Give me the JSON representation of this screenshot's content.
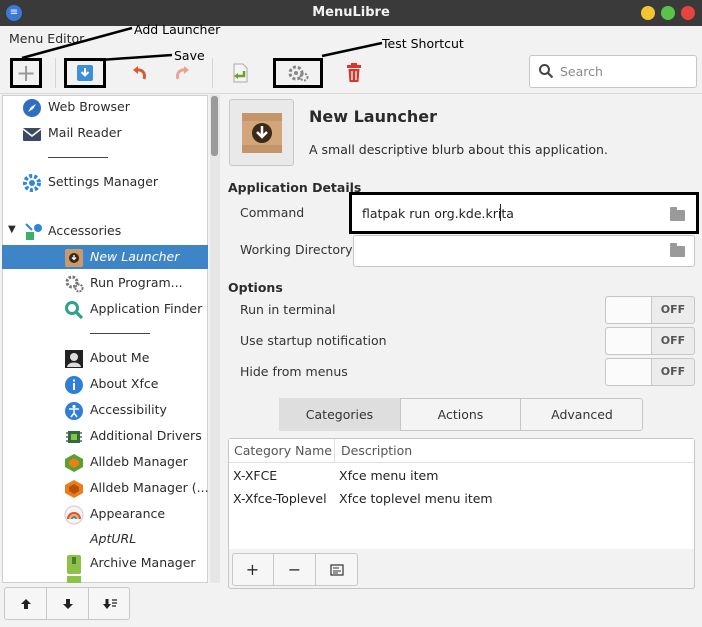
{
  "window": {
    "title": "MenuLibre",
    "app_icon": "menulibre-app-icon"
  },
  "menubar": {
    "menu_editor": "Menu Editor"
  },
  "toolbar": {
    "search_placeholder": "Search",
    "icons": [
      "add-launcher-icon",
      "save-icon",
      "undo-icon",
      "redo-icon",
      "revert-icon",
      "test-shortcut-icon",
      "delete-icon",
      "search-icon"
    ]
  },
  "annotations": {
    "add_launcher": "Add Launcher",
    "save": "Save",
    "test_shortcut": "Test Shortcut"
  },
  "tree": {
    "items": [
      {
        "label": "Web Browser",
        "icon": "web-browser-icon"
      },
      {
        "label": "Mail Reader",
        "icon": "mail-reader-icon"
      },
      {
        "label": "Settings Manager",
        "icon": "settings-manager-icon"
      },
      {
        "label": "Accessories",
        "icon": "accessories-icon"
      },
      {
        "label": "New Launcher",
        "icon": "new-launcher-icon"
      },
      {
        "label": "Run Program...",
        "icon": "run-program-icon"
      },
      {
        "label": "Application Finder",
        "icon": "application-finder-icon"
      },
      {
        "label": "About Me",
        "icon": "about-me-icon"
      },
      {
        "label": "About Xfce",
        "icon": "about-xfce-icon"
      },
      {
        "label": "Accessibility",
        "icon": "accessibility-icon"
      },
      {
        "label": "Additional Drivers",
        "icon": "additional-drivers-icon"
      },
      {
        "label": "Alldeb Manager",
        "icon": "alldeb-manager-icon"
      },
      {
        "label": "Alldeb Manager (...",
        "icon": "alldeb-manager-icon"
      },
      {
        "label": "Appearance",
        "icon": "appearance-icon"
      },
      {
        "label": "AptURL",
        "icon": ""
      },
      {
        "label": "Archive Manager",
        "icon": "archive-manager-icon"
      }
    ],
    "selected": "New Launcher",
    "move_buttons": [
      "move-up-icon",
      "move-down-icon",
      "sort-icon"
    ]
  },
  "details": {
    "name": "New Launcher",
    "comment": "A small descriptive blurb about this application.",
    "section_app_details": "Application Details",
    "command_label": "Command",
    "command_value": "flatpak run org.kde.krita",
    "workdir_label": "Working Directory",
    "workdir_value": "",
    "section_options": "Options",
    "options": [
      {
        "label": "Run in terminal",
        "state": "OFF"
      },
      {
        "label": "Use startup notification",
        "state": "OFF"
      },
      {
        "label": "Hide from menus",
        "state": "OFF"
      }
    ],
    "tabs": [
      "Categories",
      "Actions",
      "Advanced"
    ],
    "active_tab": "Categories",
    "categories": {
      "headers": [
        "Category Name",
        "Description"
      ],
      "rows": [
        [
          "X-XFCE",
          "Xfce menu item"
        ],
        [
          "X-Xfce-Toplevel",
          "Xfce toplevel menu item"
        ]
      ],
      "buttons": [
        "add-icon",
        "remove-icon",
        "clear-icon"
      ]
    }
  },
  "colors": {
    "titlebar": "#3a3a3a",
    "selection": "#3d85c6",
    "panel": "#f2f2f2"
  }
}
